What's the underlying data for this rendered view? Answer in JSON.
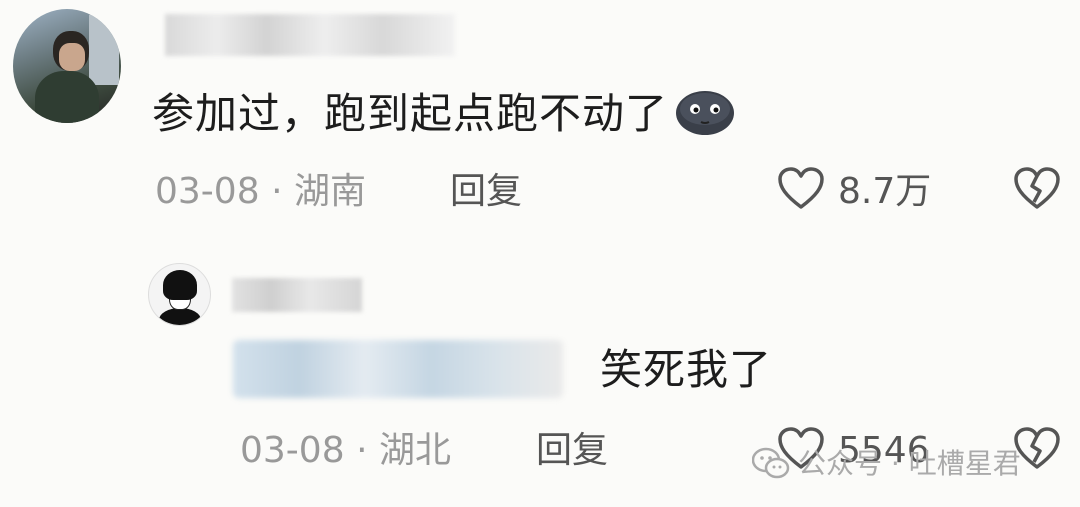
{
  "comments": [
    {
      "text": "参加过，跑到起点跑不动了",
      "emoji_icon": "dark-moon-face-emoji",
      "date": "03-08",
      "separator": "·",
      "location": "湖南",
      "reply_label": "回复",
      "like_count": "8.7万"
    },
    {
      "text": "笑死我了",
      "date": "03-08",
      "separator": "·",
      "location": "湖北",
      "reply_label": "回复",
      "like_count": "5546"
    }
  ],
  "watermark": {
    "label": "公众号 · 吐槽星君",
    "icon": "wechat-icon"
  },
  "colors": {
    "background": "#fbfbf9",
    "text": "#1d1d1d",
    "meta": "#999999",
    "action": "#555555"
  }
}
